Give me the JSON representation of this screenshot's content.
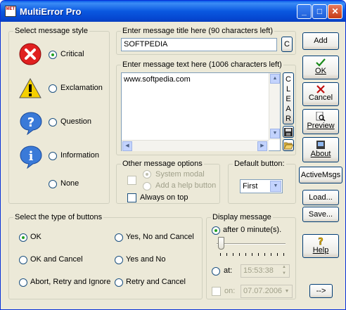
{
  "window": {
    "title": "MultiError Pro",
    "icon_text": "MET"
  },
  "titlebar": {
    "minimize": "_",
    "maximize": "□",
    "close": "✕"
  },
  "style_group": {
    "label": "Select message style",
    "options": [
      {
        "label": "Critical",
        "selected": true
      },
      {
        "label": "Exclamation",
        "selected": false
      },
      {
        "label": "Question",
        "selected": false
      },
      {
        "label": "Information",
        "selected": false
      },
      {
        "label": "None",
        "selected": false
      }
    ]
  },
  "title_group": {
    "label": "Enter message title here (90 characters left)",
    "value": "SOFTPEDIA",
    "clear_button": "C"
  },
  "text_group": {
    "label": "Enter message text here (1006 characters left)",
    "value": "www.softpedia.com",
    "clear_letters": [
      "C",
      "L",
      "E",
      "A",
      "R"
    ]
  },
  "other_options": {
    "label": "Other message options",
    "system_modal": "System modal",
    "add_help": "Add a help button",
    "always_on_top": "Always on top"
  },
  "default_button": {
    "label": "Default button:",
    "value": "First"
  },
  "buttons_group": {
    "label": "Select the type of buttons",
    "options": [
      {
        "label": "OK",
        "selected": true
      },
      {
        "label": "OK and Cancel",
        "selected": false
      },
      {
        "label": "Abort, Retry and Ignore",
        "selected": false
      },
      {
        "label": "Yes, No and Cancel",
        "selected": false
      },
      {
        "label": "Yes and No",
        "selected": false
      },
      {
        "label": "Retry and Cancel",
        "selected": false
      }
    ]
  },
  "display_group": {
    "label": "Display message",
    "after_label": "after 0 minute(s).",
    "at_label": "at:",
    "at_value": "15:53:38",
    "on_label": "on:",
    "on_value": "07.07.2006"
  },
  "side_buttons": {
    "add": "Add",
    "ok": "OK",
    "cancel": "Cancel",
    "preview": "Preview",
    "about": "About",
    "active_msgs": "ActiveMsgs",
    "load": "Load...",
    "save": "Save...",
    "help": "Help",
    "more": "-->"
  },
  "colors": {
    "titlebar": "#0a58e0",
    "critical": "#e02020",
    "warning": "#f5d000",
    "info": "#3a7ad8"
  }
}
